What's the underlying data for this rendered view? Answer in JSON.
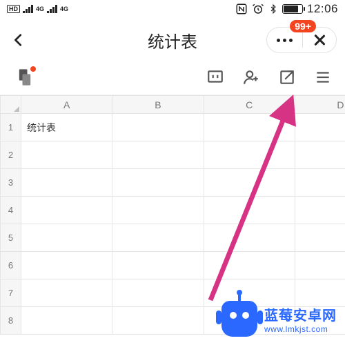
{
  "status": {
    "hd": "HD",
    "net1": "4G",
    "net2": "4G",
    "time": "12:06"
  },
  "header": {
    "title": "统计表",
    "badge": "99+"
  },
  "sheet": {
    "columns": [
      "A",
      "B",
      "C",
      "D"
    ],
    "rows": [
      {
        "num": "1",
        "cells": [
          "统计表",
          "",
          "",
          ""
        ]
      },
      {
        "num": "2",
        "cells": [
          "",
          "",
          "",
          ""
        ]
      },
      {
        "num": "3",
        "cells": [
          "",
          "",
          "",
          ""
        ]
      },
      {
        "num": "4",
        "cells": [
          "",
          "",
          "",
          ""
        ]
      },
      {
        "num": "5",
        "cells": [
          "",
          "",
          "",
          ""
        ]
      },
      {
        "num": "6",
        "cells": [
          "",
          "",
          "",
          ""
        ]
      },
      {
        "num": "7",
        "cells": [
          "",
          "",
          "",
          ""
        ]
      },
      {
        "num": "8",
        "cells": [
          "",
          "",
          "",
          ""
        ]
      }
    ]
  },
  "watermark": {
    "title": "蓝莓安卓网",
    "url": "www.lmkjst.com"
  }
}
